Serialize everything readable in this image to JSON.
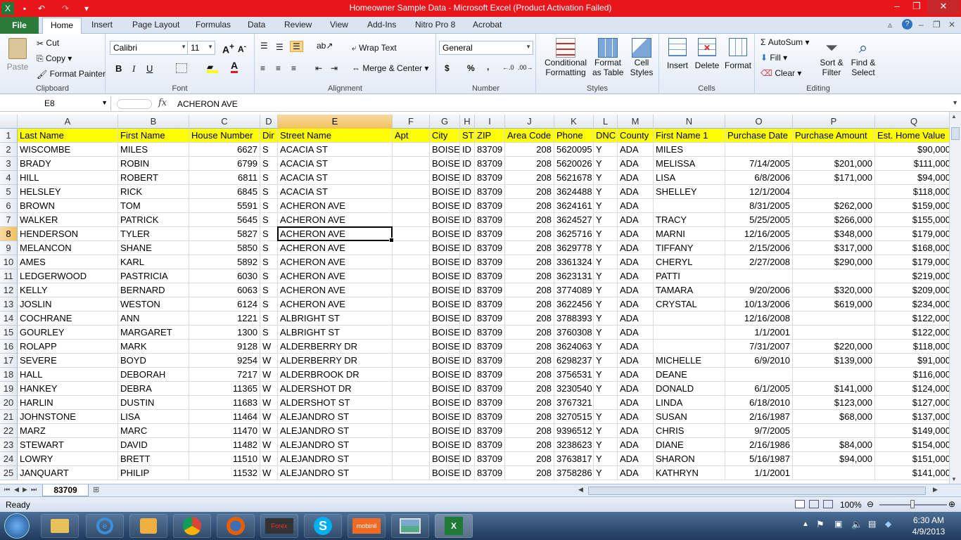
{
  "window": {
    "title": "Homeowner Sample Data  -  Microsoft Excel (Product Activation Failed)",
    "controls": {
      "minimize": "–",
      "restore": "❐",
      "close": "✕"
    }
  },
  "ribbon_tabs": [
    "File",
    "Home",
    "Insert",
    "Page Layout",
    "Formulas",
    "Data",
    "Review",
    "View",
    "Add-Ins",
    "Nitro Pro 8",
    "Acrobat"
  ],
  "clipboard": {
    "paste": "Paste",
    "cut": "Cut",
    "copy": "Copy",
    "format_painter": "Format Painter",
    "label": "Clipboard"
  },
  "font": {
    "name": "Calibri",
    "size": "11",
    "bold": "B",
    "italic": "I",
    "underline": "U",
    "label": "Font"
  },
  "alignment": {
    "wrap_text": "Wrap Text",
    "merge_center": "Merge & Center",
    "label": "Alignment"
  },
  "number": {
    "format": "General",
    "currency": "$",
    "percent": "%",
    "comma": ",",
    "label": "Number"
  },
  "styles": {
    "conditional": "Conditional",
    "conditional2": "Formatting",
    "format_as": "Format",
    "format_as2": "as Table",
    "cell_styles": "Cell",
    "cell_styles2": "Styles",
    "label": "Styles"
  },
  "cells": {
    "insert": "Insert",
    "delete": "Delete",
    "format": "Format",
    "label": "Cells"
  },
  "editing": {
    "autosum": "AutoSum",
    "fill": "Fill",
    "clear": "Clear",
    "sort": "Sort &",
    "sort2": "Filter",
    "find": "Find &",
    "find2": "Select",
    "label": "Editing"
  },
  "formula_bar": {
    "name_box": "E8",
    "fx": "fx",
    "content": "ACHERON AVE"
  },
  "columns": [
    "A",
    "B",
    "C",
    "D",
    "E",
    "F",
    "G",
    "H",
    "I",
    "J",
    "K",
    "L",
    "M",
    "N",
    "O",
    "P",
    "Q"
  ],
  "header_row": [
    "Last Name",
    "First Name",
    "House Number",
    "Dir",
    "Street Name",
    "Apt",
    "City",
    "ST",
    "ZIP",
    "Area Code",
    "Phone",
    "DNC",
    "County",
    "First Name 1",
    "Purchase Date",
    "Purchase Amount",
    "Est. Home Value"
  ],
  "rows": [
    [
      "WISCOMBE",
      "MILES",
      "6627",
      "S",
      "ACACIA ST",
      "",
      "BOISE",
      "ID",
      "83709",
      "208",
      "5620095",
      "Y",
      "ADA",
      "MILES",
      "",
      "",
      "$90,000"
    ],
    [
      "BRADY",
      "ROBIN",
      "6799",
      "S",
      "ACACIA ST",
      "",
      "BOISE",
      "ID",
      "83709",
      "208",
      "5620026",
      "Y",
      "ADA",
      "MELISSA",
      "7/14/2005",
      "$201,000",
      "$111,000"
    ],
    [
      "HILL",
      "ROBERT",
      "6811",
      "S",
      "ACACIA ST",
      "",
      "BOISE",
      "ID",
      "83709",
      "208",
      "5621678",
      "Y",
      "ADA",
      "LISA",
      "6/8/2006",
      "$171,000",
      "$94,000"
    ],
    [
      "HELSLEY",
      "RICK",
      "6845",
      "S",
      "ACACIA ST",
      "",
      "BOISE",
      "ID",
      "83709",
      "208",
      "3624488",
      "Y",
      "ADA",
      "SHELLEY",
      "12/1/2004",
      "",
      "$118,000"
    ],
    [
      "BROWN",
      "TOM",
      "5591",
      "S",
      "ACHERON AVE",
      "",
      "BOISE",
      "ID",
      "83709",
      "208",
      "3624161",
      "Y",
      "ADA",
      "",
      "8/31/2005",
      "$262,000",
      "$159,000"
    ],
    [
      "WALKER",
      "PATRICK",
      "5645",
      "S",
      "ACHERON AVE",
      "",
      "BOISE",
      "ID",
      "83709",
      "208",
      "3624527",
      "Y",
      "ADA",
      "TRACY",
      "5/25/2005",
      "$266,000",
      "$155,000"
    ],
    [
      "HENDERSON",
      "TYLER",
      "5827",
      "S",
      "ACHERON AVE",
      "",
      "BOISE",
      "ID",
      "83709",
      "208",
      "3625716",
      "Y",
      "ADA",
      "MARNI",
      "12/16/2005",
      "$348,000",
      "$179,000"
    ],
    [
      "MELANCON",
      "SHANE",
      "5850",
      "S",
      "ACHERON AVE",
      "",
      "BOISE",
      "ID",
      "83709",
      "208",
      "3629778",
      "Y",
      "ADA",
      "TIFFANY",
      "2/15/2006",
      "$317,000",
      "$168,000"
    ],
    [
      "AMES",
      "KARL",
      "5892",
      "S",
      "ACHERON AVE",
      "",
      "BOISE",
      "ID",
      "83709",
      "208",
      "3361324",
      "Y",
      "ADA",
      "CHERYL",
      "2/27/2008",
      "$290,000",
      "$179,000"
    ],
    [
      "LEDGERWOOD",
      "PASTRICIA",
      "6030",
      "S",
      "ACHERON AVE",
      "",
      "BOISE",
      "ID",
      "83709",
      "208",
      "3623131",
      "Y",
      "ADA",
      "PATTI",
      "",
      "",
      "$219,000"
    ],
    [
      "KELLY",
      "BERNARD",
      "6063",
      "S",
      "ACHERON AVE",
      "",
      "BOISE",
      "ID",
      "83709",
      "208",
      "3774089",
      "Y",
      "ADA",
      "TAMARA",
      "9/20/2006",
      "$320,000",
      "$209,000"
    ],
    [
      "JOSLIN",
      "WESTON",
      "6124",
      "S",
      "ACHERON AVE",
      "",
      "BOISE",
      "ID",
      "83709",
      "208",
      "3622456",
      "Y",
      "ADA",
      "CRYSTAL",
      "10/13/2006",
      "$619,000",
      "$234,000"
    ],
    [
      "COCHRANE",
      "ANN",
      "1221",
      "S",
      "ALBRIGHT ST",
      "",
      "BOISE",
      "ID",
      "83709",
      "208",
      "3788393",
      "Y",
      "ADA",
      "",
      "12/16/2008",
      "",
      "$122,000"
    ],
    [
      "GOURLEY",
      "MARGARET",
      "1300",
      "S",
      "ALBRIGHT ST",
      "",
      "BOISE",
      "ID",
      "83709",
      "208",
      "3760308",
      "Y",
      "ADA",
      "",
      "1/1/2001",
      "",
      "$122,000"
    ],
    [
      "ROLAPP",
      "MARK",
      "9128",
      "W",
      "ALDERBERRY DR",
      "",
      "BOISE",
      "ID",
      "83709",
      "208",
      "3624063",
      "Y",
      "ADA",
      "",
      "7/31/2007",
      "$220,000",
      "$118,000"
    ],
    [
      "SEVERE",
      "BOYD",
      "9254",
      "W",
      "ALDERBERRY DR",
      "",
      "BOISE",
      "ID",
      "83709",
      "208",
      "6298237",
      "Y",
      "ADA",
      "MICHELLE",
      "6/9/2010",
      "$139,000",
      "$91,000"
    ],
    [
      "HALL",
      "DEBORAH",
      "7217",
      "W",
      "ALDERBROOK DR",
      "",
      "BOISE",
      "ID",
      "83709",
      "208",
      "3756531",
      "Y",
      "ADA",
      "DEANE",
      "",
      "",
      "$116,000"
    ],
    [
      "HANKEY",
      "DEBRA",
      "11365",
      "W",
      "ALDERSHOT DR",
      "",
      "BOISE",
      "ID",
      "83709",
      "208",
      "3230540",
      "Y",
      "ADA",
      "DONALD",
      "6/1/2005",
      "$141,000",
      "$124,000"
    ],
    [
      "HARLIN",
      "DUSTIN",
      "11683",
      "W",
      "ALDERSHOT ST",
      "",
      "BOISE",
      "ID",
      "83709",
      "208",
      "3767321",
      "",
      "ADA",
      "LINDA",
      "6/18/2010",
      "$123,000",
      "$127,000"
    ],
    [
      "JOHNSTONE",
      "LISA",
      "11464",
      "W",
      "ALEJANDRO ST",
      "",
      "BOISE",
      "ID",
      "83709",
      "208",
      "3270515",
      "Y",
      "ADA",
      "SUSAN",
      "2/16/1987",
      "$68,000",
      "$137,000"
    ],
    [
      "MARZ",
      "MARC",
      "11470",
      "W",
      "ALEJANDRO ST",
      "",
      "BOISE",
      "ID",
      "83709",
      "208",
      "9396512",
      "Y",
      "ADA",
      "CHRIS",
      "9/7/2005",
      "",
      "$149,000"
    ],
    [
      "STEWART",
      "DAVID",
      "11482",
      "W",
      "ALEJANDRO ST",
      "",
      "BOISE",
      "ID",
      "83709",
      "208",
      "3238623",
      "Y",
      "ADA",
      "DIANE",
      "2/16/1986",
      "$84,000",
      "$154,000"
    ],
    [
      "LOWRY",
      "BRETT",
      "11510",
      "W",
      "ALEJANDRO ST",
      "",
      "BOISE",
      "ID",
      "83709",
      "208",
      "3763817",
      "Y",
      "ADA",
      "SHARON",
      "5/16/1987",
      "$94,000",
      "$151,000"
    ],
    [
      "JANQUART",
      "PHILIP",
      "11532",
      "W",
      "ALEJANDRO ST",
      "",
      "BOISE",
      "ID",
      "83709",
      "208",
      "3758286",
      "Y",
      "ADA",
      "KATHRYN",
      "1/1/2001",
      "",
      "$141,000"
    ]
  ],
  "sheet_tab": "83709",
  "status": {
    "ready": "Ready",
    "zoom": "100%"
  },
  "clock": {
    "time": "6:30 AM",
    "date": "4/9/2013"
  },
  "taskbar_items": [
    "start-orb",
    "explorer",
    "internet-explorer",
    "media-player",
    "chrome",
    "firefox",
    "forex",
    "skype",
    "mobinil",
    "photos",
    "excel"
  ],
  "colors": {
    "title_bar": "#e8161b",
    "file_tab": "#2a7a3a",
    "header_fill": "#ffff00",
    "selected_header": "#f1c15f"
  }
}
